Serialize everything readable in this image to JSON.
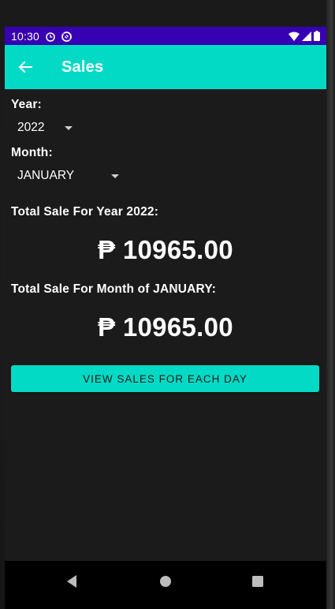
{
  "status_bar": {
    "time": "10:30",
    "background": "#3700b3",
    "icons_left": [
      "clock-icon",
      "no-disturb-icon"
    ],
    "icons_right": [
      "wifi-icon",
      "signal-icon",
      "battery-icon"
    ]
  },
  "app_bar": {
    "title": "Sales",
    "background": "#03dac5",
    "back_icon": "arrow-left-icon"
  },
  "filters": {
    "year_label": "Year:",
    "year_value": "2022",
    "month_label": "Month:",
    "month_value": "JANUARY"
  },
  "totals": {
    "year_heading": "Total Sale For Year 2022:",
    "year_amount": "₱ 10965.00",
    "month_heading": "Total Sale For Month of JANUARY:",
    "month_amount": "₱ 10965.00"
  },
  "actions": {
    "view_daily_label": "VIEW SALES FOR EACH DAY"
  },
  "nav_bar": {
    "items": [
      "back-triangle-icon",
      "home-circle-icon",
      "recents-square-icon"
    ]
  },
  "colors": {
    "accent": "#03dac5",
    "primary_dark": "#3700b3",
    "background": "#1b1b1b",
    "text": "#ffffff"
  }
}
